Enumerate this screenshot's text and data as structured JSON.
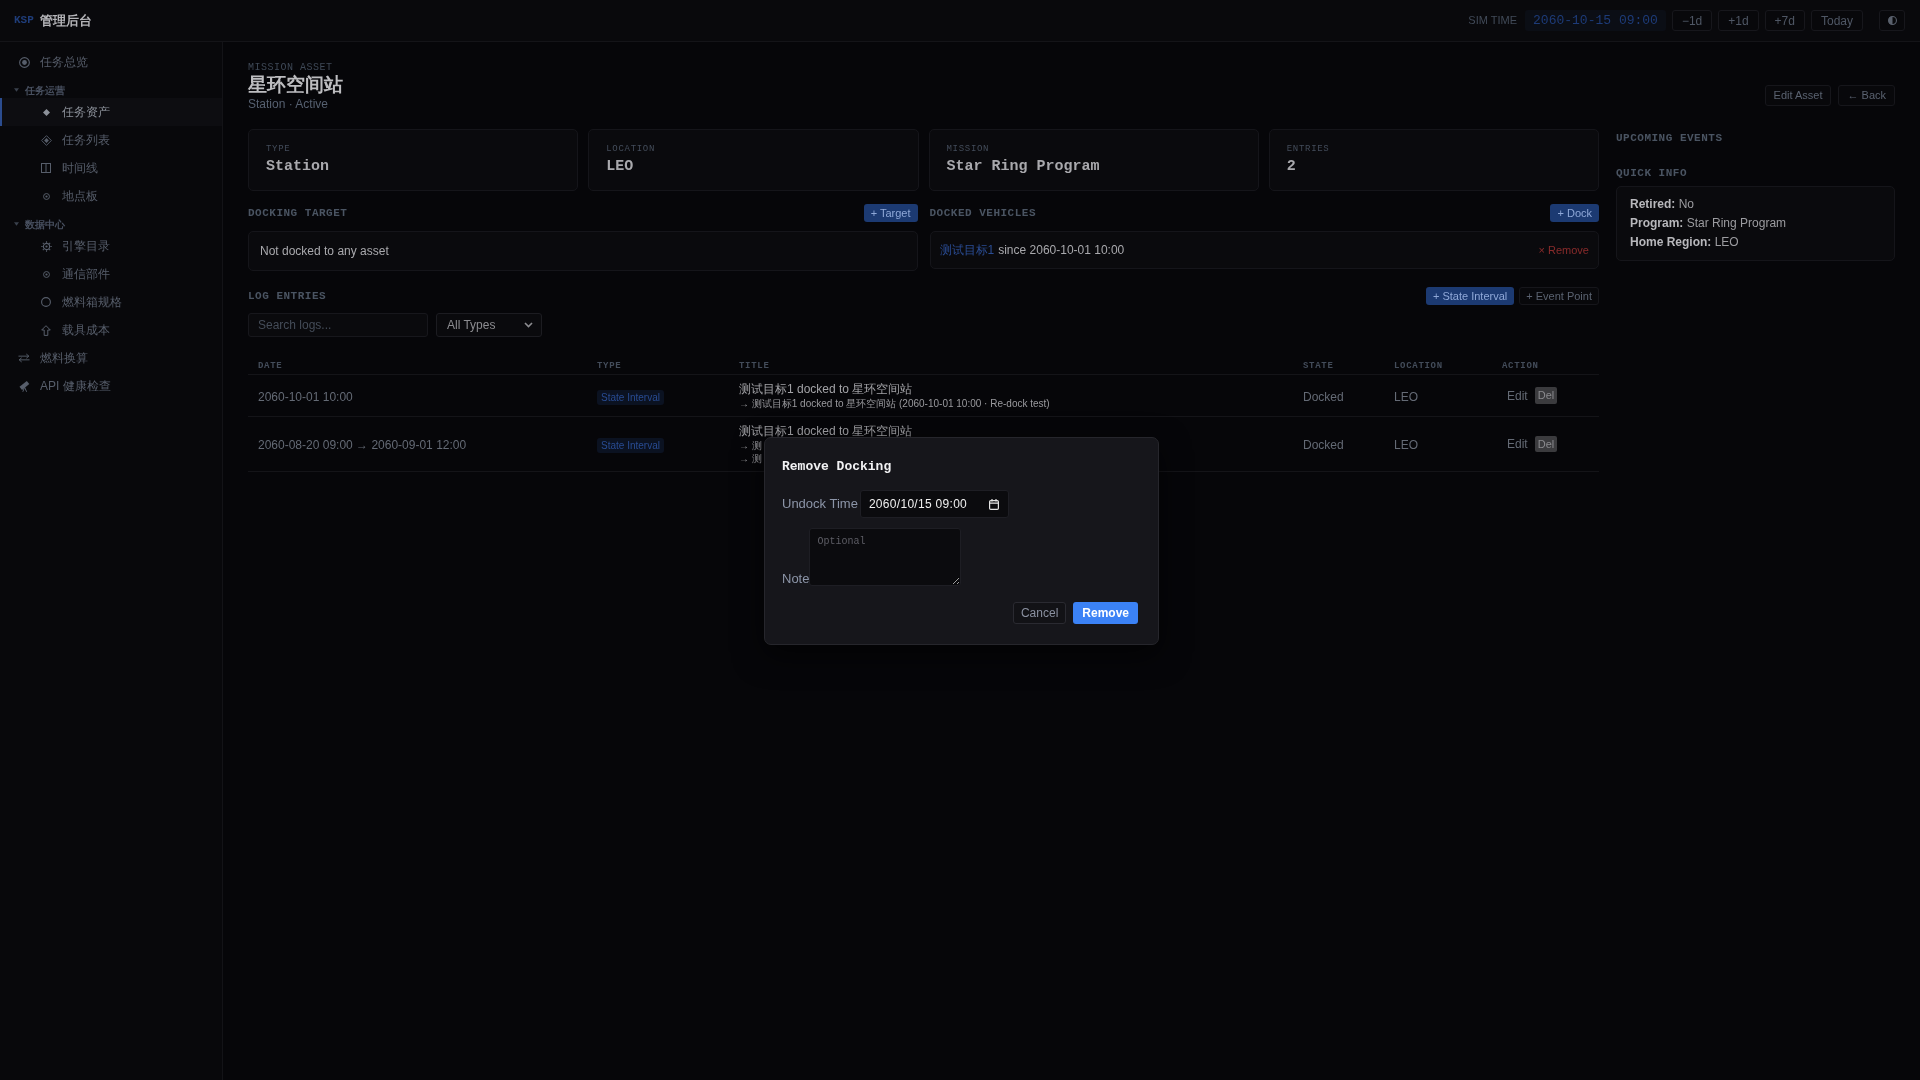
{
  "header": {
    "logo": "KSP",
    "title": "管理后台",
    "sim_time_label": "SIM TIME",
    "sim_time": "2060-10-15 09:00",
    "buttons": [
      "−1d",
      "+1d",
      "+7d",
      "Today"
    ]
  },
  "sidebar": {
    "items": [
      {
        "kind": "link",
        "label": "任务总览",
        "selected": false
      },
      {
        "kind": "group",
        "label": "任务运营",
        "expanded": true,
        "children": [
          {
            "kind": "link",
            "label": "任务资产",
            "selected": true
          },
          {
            "kind": "link",
            "label": "任务列表",
            "selected": false
          },
          {
            "kind": "link",
            "label": "时间线",
            "selected": false
          },
          {
            "kind": "link",
            "label": "地点板",
            "selected": false
          }
        ]
      },
      {
        "kind": "group",
        "label": "数据中心",
        "expanded": true,
        "children": [
          {
            "kind": "link",
            "label": "引擎目录",
            "selected": false
          },
          {
            "kind": "link",
            "label": "通信部件",
            "selected": false
          },
          {
            "kind": "link",
            "label": "燃料箱规格",
            "selected": false
          },
          {
            "kind": "link",
            "label": "载具成本",
            "selected": false
          }
        ]
      },
      {
        "kind": "link",
        "label": "燃料换算",
        "selected": false
      },
      {
        "kind": "link",
        "label": "API 健康检查",
        "selected": false
      }
    ]
  },
  "asset": {
    "eyebrow": "MISSION ASSET",
    "title": "星环空间站",
    "subtitle": "Station · Active",
    "actions": [
      "Edit Asset",
      "← Back"
    ]
  },
  "stats": [
    {
      "label": "TYPE",
      "value": "Station"
    },
    {
      "label": "LOCATION",
      "value": "LEO"
    },
    {
      "label": "MISSION",
      "value": "Star Ring Program"
    },
    {
      "label": "ENTRIES",
      "value": "2"
    }
  ],
  "docking_target": {
    "heading": "DOCKING TARGET",
    "add_button": "+ Target",
    "empty_text": "Not docked to any asset"
  },
  "docked_vehicles": {
    "heading": "DOCKED VEHICLES",
    "add_button": "+ Dock",
    "items": [
      {
        "name": "测试目标1",
        "since": "since 2060-10-01 10:00",
        "remove": "× Remove"
      }
    ]
  },
  "log_entries": {
    "heading": "LOG ENTRIES",
    "buttons": [
      {
        "label": "+ State Interval",
        "kind": "primary"
      },
      {
        "label": "+ Event Point",
        "kind": "secondary"
      }
    ],
    "search": {
      "placeholder": "Search logs..."
    },
    "filter": {
      "value": "All Types"
    },
    "table": {
      "columns": [
        "DATE",
        "TYPE",
        "TITLE",
        "STATE",
        "LOCATION",
        "ACTION"
      ],
      "rows": [
        {
          "date": "2060-10-01 10:00",
          "type": "State Interval",
          "title": "测试目标1 docked to 星环空间站",
          "details": [
            "→ 测试目标1 docked to 星环空间站 (2060-10-01 10:00 · Re-dock test)"
          ],
          "state": "Docked",
          "location": "LEO",
          "actions": [
            {
              "label": "Edit",
              "kind": "link"
            },
            {
              "label": "Del",
              "kind": "danger"
            }
          ]
        },
        {
          "date": "2060-08-20 09:00 → 2060-09-01 12:00",
          "type": "State Interval",
          "title": "测试目标1 docked to 星环空间站",
          "details": [
            "→ 测",
            "→ 测"
          ],
          "state": "Docked",
          "location": "LEO",
          "actions": [
            {
              "label": "Edit",
              "kind": "link"
            },
            {
              "label": "Del",
              "kind": "danger"
            }
          ]
        }
      ]
    }
  },
  "upcoming_events": {
    "heading": "UPCOMING EVENTS"
  },
  "quick_info": {
    "heading": "QUICK INFO",
    "lines": [
      "**Retired:** No",
      "**Program:** Star Ring Program",
      "**Home Region:** LEO"
    ]
  },
  "modal": {
    "title": "Remove Docking",
    "fields": [
      {
        "label": "Undock Time",
        "kind": "datetime",
        "value": "2060/10/15 09:00"
      },
      {
        "label": "Note",
        "kind": "textarea",
        "placeholder": "Optional"
      }
    ],
    "buttons": [
      {
        "label": "Cancel",
        "kind": "cancel"
      },
      {
        "label": "Remove",
        "kind": "confirm"
      }
    ]
  }
}
